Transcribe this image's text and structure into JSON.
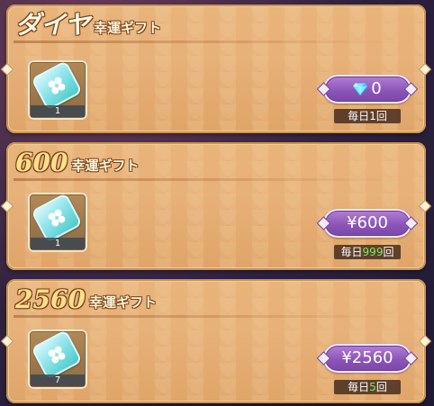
{
  "cards": [
    {
      "title_big": "ダイヤ",
      "title_small": "幸運ギフト",
      "item_qty": "1",
      "price": "0",
      "price_icon": "diamond-icon",
      "limit_prefix": "毎日",
      "limit_count": "1",
      "limit_suffix": "回"
    },
    {
      "title_big": "600",
      "title_small": "幸運ギフト",
      "item_qty": "1",
      "price": "¥600",
      "limit_prefix": "毎日",
      "limit_count": "999",
      "limit_suffix": "回"
    },
    {
      "title_big": "2560",
      "title_small": "幸運ギフト",
      "item_qty": "7",
      "price": "¥2560",
      "limit_prefix": "毎日",
      "limit_count": "5",
      "limit_suffix": "回"
    }
  ],
  "colors": {
    "card_bg": "#e7b17a",
    "button_purple": "#8b55b8",
    "limit_green": "#7ee76a"
  }
}
